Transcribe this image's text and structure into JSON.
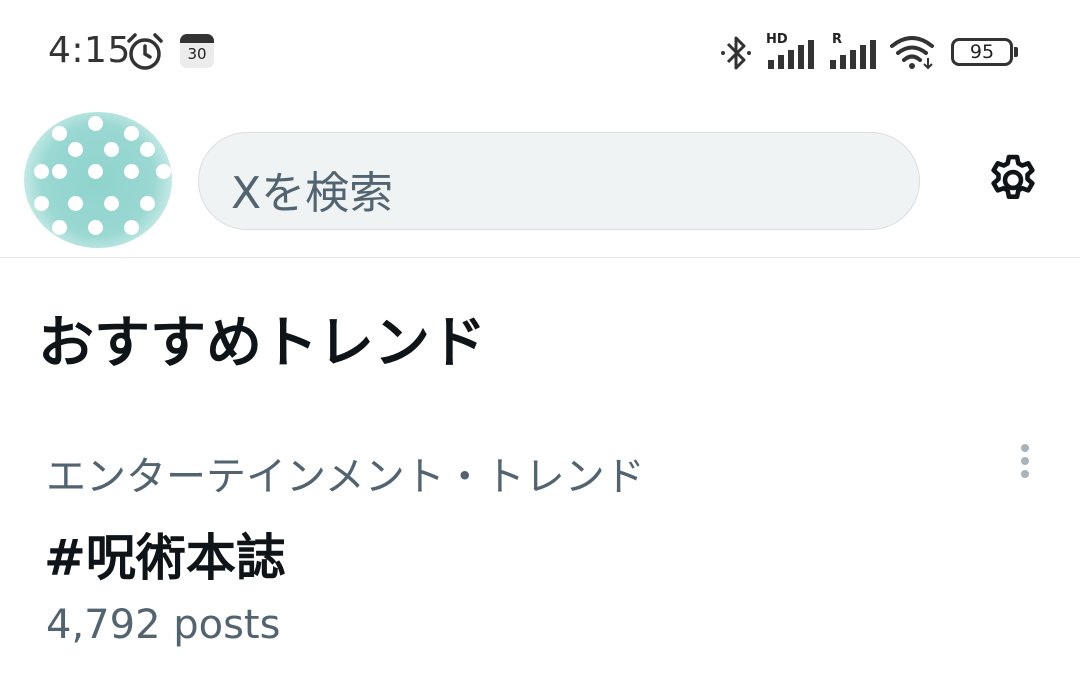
{
  "status_bar": {
    "time": "4:15",
    "calendar_day": "30",
    "signal1_label": "HD",
    "signal2_label": "R",
    "battery": "95",
    "icons": [
      "alarm-icon",
      "calendar-icon",
      "bluetooth-icon",
      "signal-icon",
      "wifi-icon",
      "battery-icon"
    ]
  },
  "header": {
    "search_placeholder": "Xを検索",
    "settings_icon": "gear-icon"
  },
  "section": {
    "title": "おすすめトレンド"
  },
  "trends": [
    {
      "category": "エンターテインメント・トレンド",
      "name": "#呪術本誌",
      "posts": "4,792 posts"
    }
  ],
  "colors": {
    "text_primary": "#0f1419",
    "text_secondary": "#536471",
    "search_bg": "#eff3f4",
    "avatar": "#8fd3cd"
  }
}
